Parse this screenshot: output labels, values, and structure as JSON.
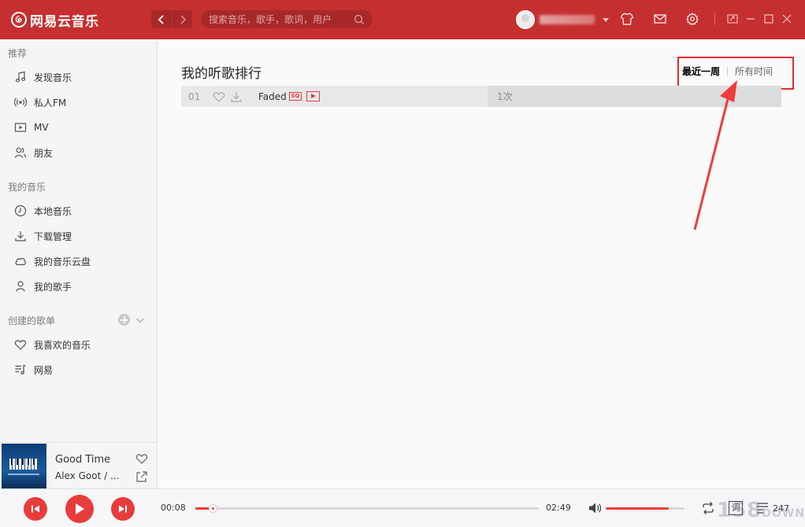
{
  "app": {
    "title": "网易云音乐"
  },
  "search": {
    "placeholder": "搜索音乐，歌手，歌词，用户"
  },
  "sidebar": {
    "section_recommend": "推荐",
    "recommend_items": [
      {
        "label": "发现音乐",
        "icon": "music-note-icon"
      },
      {
        "label": "私人FM",
        "icon": "radio-icon"
      },
      {
        "label": "MV",
        "icon": "video-icon"
      },
      {
        "label": "朋友",
        "icon": "friends-icon"
      }
    ],
    "section_my_music": "我的音乐",
    "my_music_items": [
      {
        "label": "本地音乐",
        "icon": "local-music-icon"
      },
      {
        "label": "下载管理",
        "icon": "download-icon"
      },
      {
        "label": "我的音乐云盘",
        "icon": "cloud-icon"
      },
      {
        "label": "我的歌手",
        "icon": "singer-icon"
      }
    ],
    "section_created": "创建的歌单",
    "created_items": [
      {
        "label": "我喜欢的音乐",
        "icon": "heart-icon"
      },
      {
        "label": "网易",
        "icon": "playlist-icon"
      }
    ]
  },
  "main": {
    "page_title": "我的听歌排行",
    "range_tabs": [
      "最近一周",
      "所有时间"
    ],
    "active_tab": "最近一周",
    "songs": [
      {
        "index": "01",
        "title": "Faded",
        "quality_badge": "SQ",
        "play_count": "1次",
        "play_share": 0.51
      }
    ]
  },
  "now_playing": {
    "title": "Good Time",
    "artist": "Alex Goot / ..."
  },
  "player": {
    "elapsed": "00:08",
    "duration": "02:49",
    "progress": 0.05,
    "volume": 0.8,
    "playlist_count": "247",
    "lyric_label": "词"
  },
  "watermark": {
    "text": "158",
    "suffix": "DOWN"
  },
  "colors": {
    "brand_red": "#c62f2f",
    "accent_red": "#e83c3c",
    "highlight_red": "#e02b2b"
  }
}
